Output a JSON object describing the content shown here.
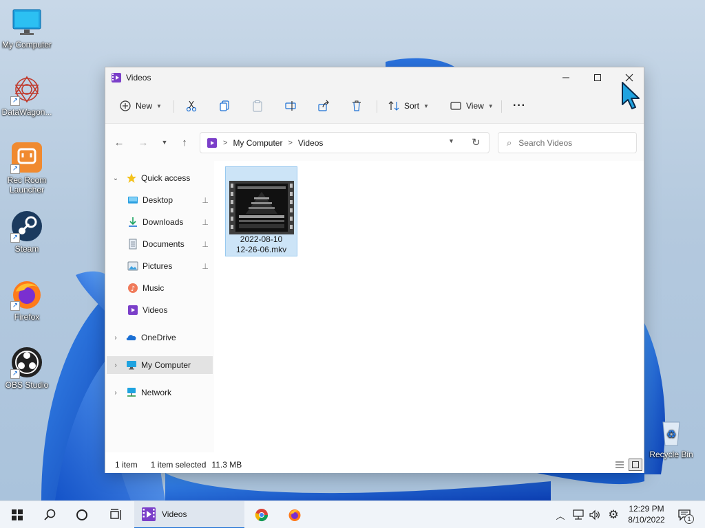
{
  "desktop": {
    "icons": [
      {
        "label": "My Computer",
        "icon": "monitor-icon"
      },
      {
        "label": "DataWagon...",
        "icon": "datawagon-icon"
      },
      {
        "label": "Rec Room Launcher",
        "icon": "rec-room-icon"
      },
      {
        "label": "Steam",
        "icon": "steam-icon"
      },
      {
        "label": "Firefox",
        "icon": "firefox-icon"
      },
      {
        "label": "OBS Studio",
        "icon": "obs-icon"
      },
      {
        "label": "Recycle Bin",
        "icon": "recycle-bin-icon"
      }
    ]
  },
  "window": {
    "title": "Videos",
    "commands": {
      "new_label": "New",
      "sort_label": "Sort",
      "view_label": "View",
      "more_label": "···"
    },
    "address": {
      "crumbs": [
        "My Computer",
        "Videos"
      ]
    },
    "search": {
      "placeholder": "Search Videos",
      "value": ""
    },
    "nav": {
      "quick_access": "Quick access",
      "items": [
        {
          "label": "Desktop",
          "icon": "desktop-folder-icon",
          "pinned": true
        },
        {
          "label": "Downloads",
          "icon": "downloads-icon",
          "pinned": true
        },
        {
          "label": "Documents",
          "icon": "documents-icon",
          "pinned": true
        },
        {
          "label": "Pictures",
          "icon": "pictures-icon",
          "pinned": true
        },
        {
          "label": "Music",
          "icon": "music-icon",
          "pinned": false
        },
        {
          "label": "Videos",
          "icon": "videos-icon",
          "pinned": false
        }
      ],
      "onedrive": "OneDrive",
      "my_computer": "My Computer",
      "network": "Network",
      "pin_glyph": "📌"
    },
    "files": [
      {
        "name_line1": "2022-08-10",
        "name_line2": "12-26-06.mkv",
        "selected": true
      }
    ],
    "status": {
      "count": "1 item",
      "selection": "1 item selected",
      "size": "11.3 MB"
    }
  },
  "taskbar": {
    "active_app_label": "Videos",
    "clock_time": "12:29 PM",
    "clock_date": "8/10/2022",
    "notification_count": "1"
  },
  "colors": {
    "accent": "#1a6fd4",
    "selection_bg": "#cce4f7",
    "selection_border": "#99c9ef",
    "videos_purple": "#7b3fc9"
  }
}
